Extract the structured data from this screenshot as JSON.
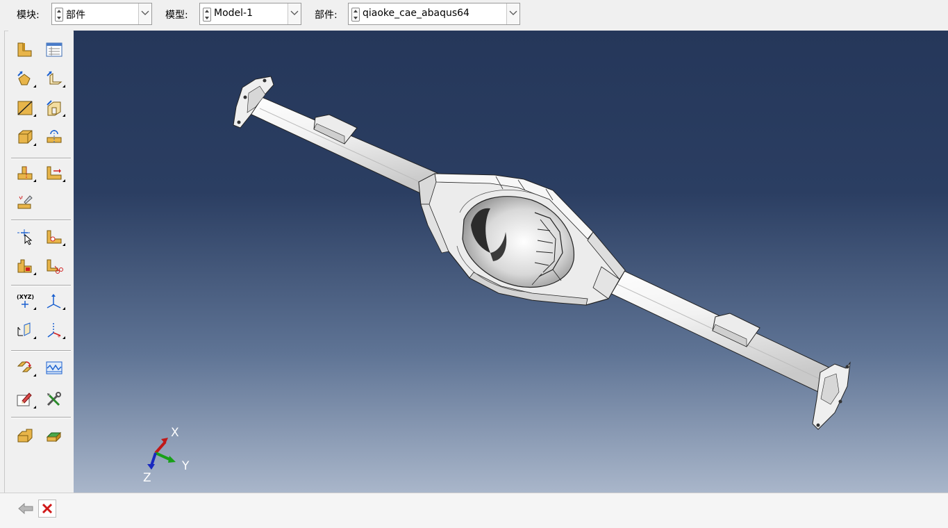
{
  "context_bar": {
    "module_label": "模块:",
    "module_value": "部件",
    "model_label": "模型:",
    "model_value": "Model-1",
    "part_label": "部件:",
    "part_value": "qiaoke_cae_abaqus64"
  },
  "toolbox": {
    "tools": [
      "create-part-icon",
      "part-manager-icon",
      "create-solid-extrude-icon",
      "create-shell-icon",
      "create-wire-icon",
      "create-cut-icon",
      "create-solid-feature-icon",
      "round-fillet-icon",
      "partition-cell-icon",
      "partition-edge-icon",
      "repair-tool-icon",
      "create-datum-point-icon",
      "query-icon",
      "feature-manager-icon",
      "cut-split-icon",
      "create-datum-xyz-icon",
      "datum-csys-icon",
      "datum-plane-icon",
      "datum-axis-icon",
      "edit-feature-icon",
      "wave-feature-icon",
      "edit-sketch-icon",
      "tools-icon",
      "set-manager-icon",
      "surface-manager-icon"
    ]
  },
  "viewport": {
    "triad": {
      "x_label": "X",
      "y_label": "Y",
      "z_label": "Z"
    },
    "background_top": "#25375a",
    "background_bottom": "#a9b6ca"
  },
  "prompt_bar": {
    "back_icon": "back-arrow-icon",
    "cancel_icon": "cancel-x-icon"
  }
}
